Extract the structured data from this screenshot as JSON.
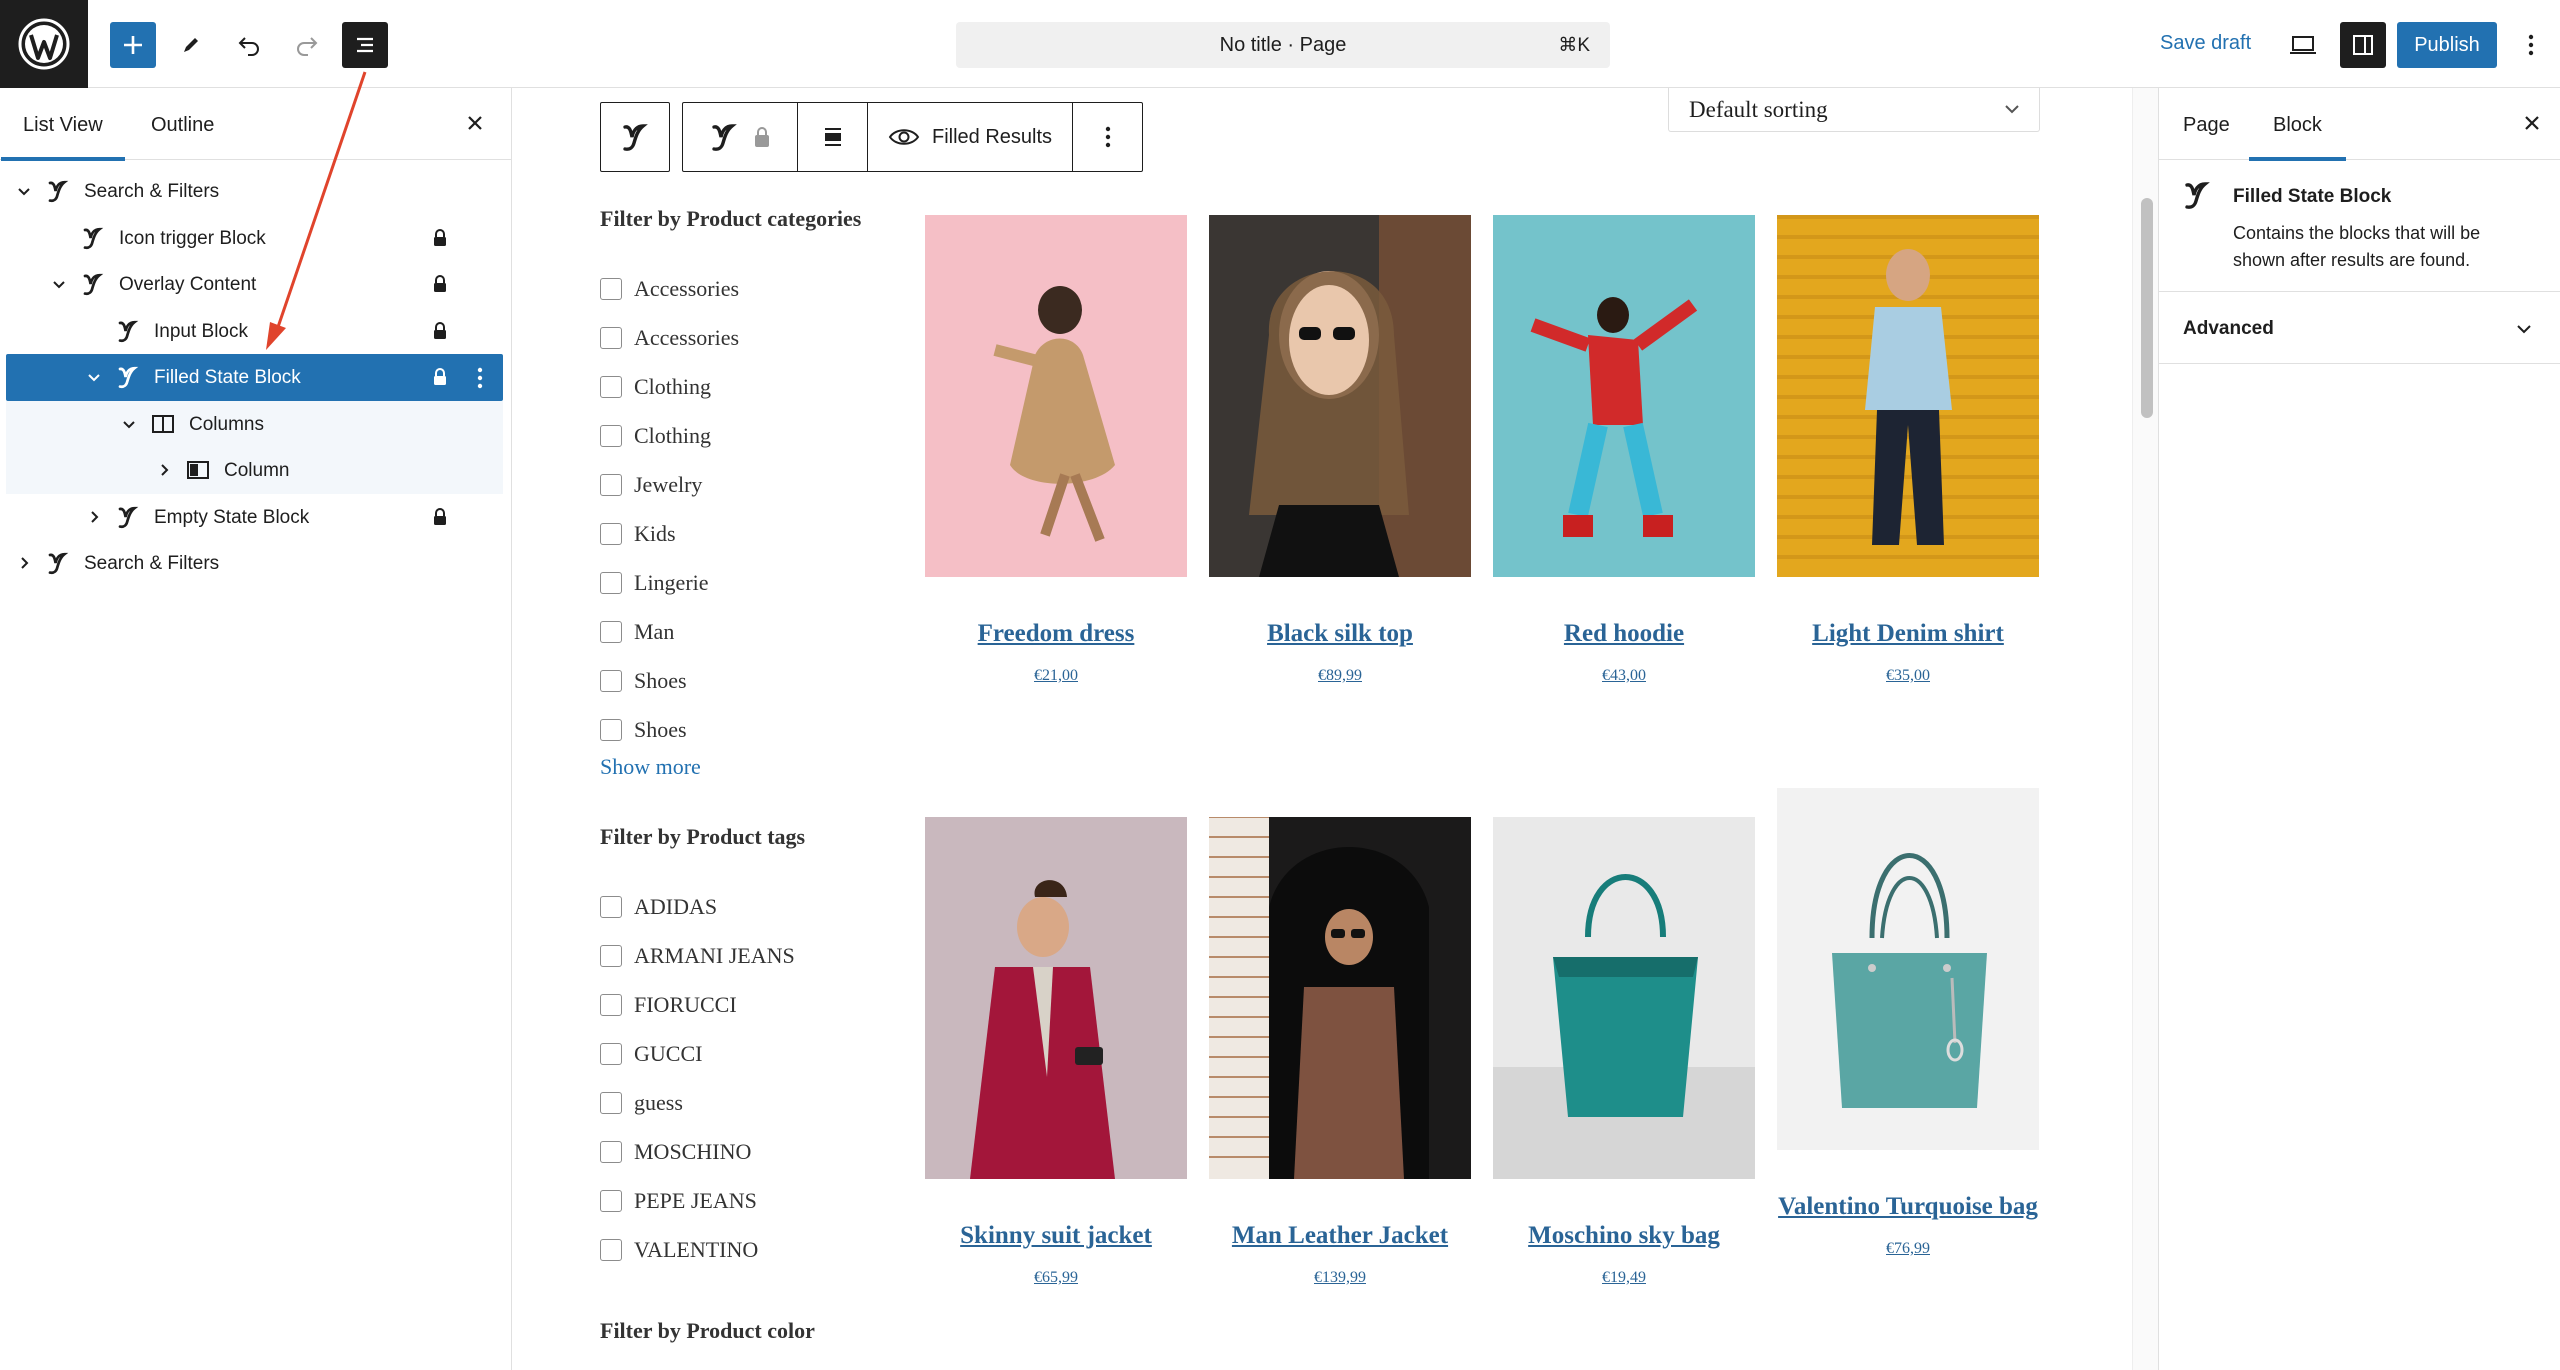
{
  "topbar": {
    "command_title": "No title · Page",
    "command_shortcut": "⌘K",
    "save_draft": "Save draft",
    "publish": "Publish",
    "icons": [
      "wordpress-logo-icon",
      "plus-icon",
      "pencil-icon",
      "undo-icon",
      "redo-icon",
      "list-view-icon",
      "desktop-preview-icon",
      "sidebar-settings-icon",
      "more-vertical-icon"
    ]
  },
  "list_panel": {
    "tabs": [
      "List View",
      "Outline"
    ],
    "active_tab": "List View",
    "items": [
      {
        "label": "Search & Filters",
        "depth": 0,
        "expanded": true,
        "locked": false
      },
      {
        "label": "Icon trigger Block",
        "depth": 1,
        "expanded": null,
        "locked": true
      },
      {
        "label": "Overlay Content",
        "depth": 1,
        "expanded": true,
        "locked": true
      },
      {
        "label": "Input Block",
        "depth": 2,
        "expanded": null,
        "locked": true
      },
      {
        "label": "Filled State Block",
        "depth": 2,
        "expanded": true,
        "locked": true,
        "selected": true
      },
      {
        "label": "Columns",
        "depth": 3,
        "expanded": true,
        "locked": false
      },
      {
        "label": "Column",
        "depth": 4,
        "expanded": false,
        "locked": false
      },
      {
        "label": "Empty State Block",
        "depth": 2,
        "expanded": false,
        "locked": true
      },
      {
        "label": "Search & Filters",
        "depth": 0,
        "expanded": false,
        "locked": false
      }
    ]
  },
  "block_toolbar": {
    "filled_results": "Filled Results"
  },
  "canvas": {
    "sorting": "Default sorting",
    "filters": {
      "categories": {
        "heading": "Filter by Product categories",
        "options": [
          "Accessories",
          "Accessories",
          "Clothing",
          "Clothing",
          "Jewelry",
          "Kids",
          "Lingerie",
          "Man",
          "Shoes",
          "Shoes"
        ],
        "show_more": "Show more"
      },
      "tags": {
        "heading": "Filter by Product tags",
        "options": [
          "ADIDAS",
          "ARMANI JEANS",
          "FIORUCCI",
          "GUCCI",
          "guess",
          "MOSCHINO",
          "PEPE JEANS",
          "VALENTINO"
        ]
      },
      "color": {
        "heading": "Filter by Product color"
      }
    },
    "products": [
      {
        "name": "Freedom dress",
        "price": "€21,00",
        "bg": "#f5bfc6"
      },
      {
        "name": "Black silk top",
        "price": "€89,99",
        "bg": "#3a3633"
      },
      {
        "name": "Red hoodie",
        "price": "€43,00",
        "bg": "#74c3cb"
      },
      {
        "name": "Light Denim shirt",
        "price": "€35,00",
        "bg": "#e3a71e"
      },
      {
        "name": "Skinny suit jacket",
        "price": "€65,99",
        "bg": "#c9b8be"
      },
      {
        "name": "Man Leather Jacket",
        "price": "€139,99",
        "bg": "#1b1a1a"
      },
      {
        "name": "Moschino sky bag",
        "price": "€19,49",
        "bg": "#e9e9e9"
      },
      {
        "name": "Valentino Turquoise bag",
        "price": "€76,99",
        "bg": "#f2f2f2"
      }
    ]
  },
  "settings_panel": {
    "tabs": [
      "Page",
      "Block"
    ],
    "active_tab": "Block",
    "block_title": "Filled State Block",
    "block_description": "Contains the blocks that will be shown after results are found.",
    "advanced": "Advanced"
  },
  "colors": {
    "accent": "#2271b1",
    "dark": "#1e1e1e",
    "link": "#2a6496",
    "annotation_arrow": "#e0442c"
  }
}
